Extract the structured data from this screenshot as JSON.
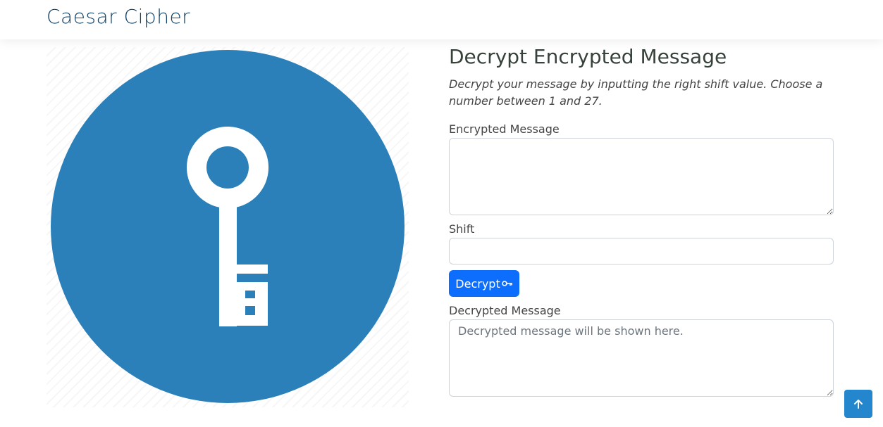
{
  "header": {
    "brand": "Caesar Cipher"
  },
  "main": {
    "title": "Decrypt Encrypted Message",
    "description": "Decrypt your message by inputting the right shift value. Choose a number between 1 and 27.",
    "encrypted": {
      "label": "Encrypted Message",
      "value": "",
      "placeholder": ""
    },
    "shift": {
      "label": "Shift",
      "value": "",
      "placeholder": ""
    },
    "decrypt_button": {
      "label": "Decrypt",
      "icon": "key-icon"
    },
    "decrypted": {
      "label": "Decrypted Message",
      "value": "",
      "placeholder": "Decrypted message will be shown here."
    }
  },
  "hero": {
    "icon": "key-icon",
    "circle_color": "#2b80b9"
  },
  "back_to_top": {
    "icon": "arrow-up-icon",
    "color": "#2487ce"
  },
  "colors": {
    "brand": "#124265",
    "button": "#0d6efd"
  }
}
